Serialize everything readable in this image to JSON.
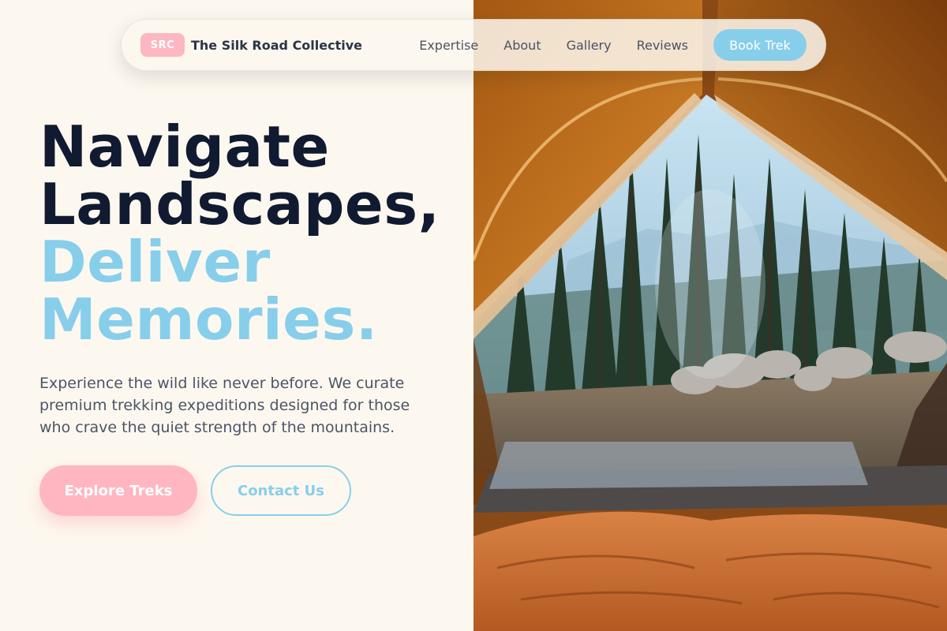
{
  "brand": {
    "badge": "SRC",
    "name": "The Silk Road Collective"
  },
  "nav": {
    "links": [
      "Expertise",
      "About",
      "Gallery",
      "Reviews"
    ],
    "cta": "Book Trek"
  },
  "hero": {
    "headline_dark": [
      "Navigate",
      "Landscapes,"
    ],
    "headline_light": [
      "Deliver",
      "Memories."
    ],
    "subtext": "Experience the wild like never before. We curate premium trekking expeditions designed for those who crave the quiet strength of the mountains.",
    "primary_button": "Explore Treks",
    "secondary_button": "Contact Us"
  },
  "colors": {
    "background": "#fdf8ef",
    "accent_pink": "#ffb6c1",
    "accent_blue": "#87ceeb",
    "headline_dark": "#101a30"
  }
}
